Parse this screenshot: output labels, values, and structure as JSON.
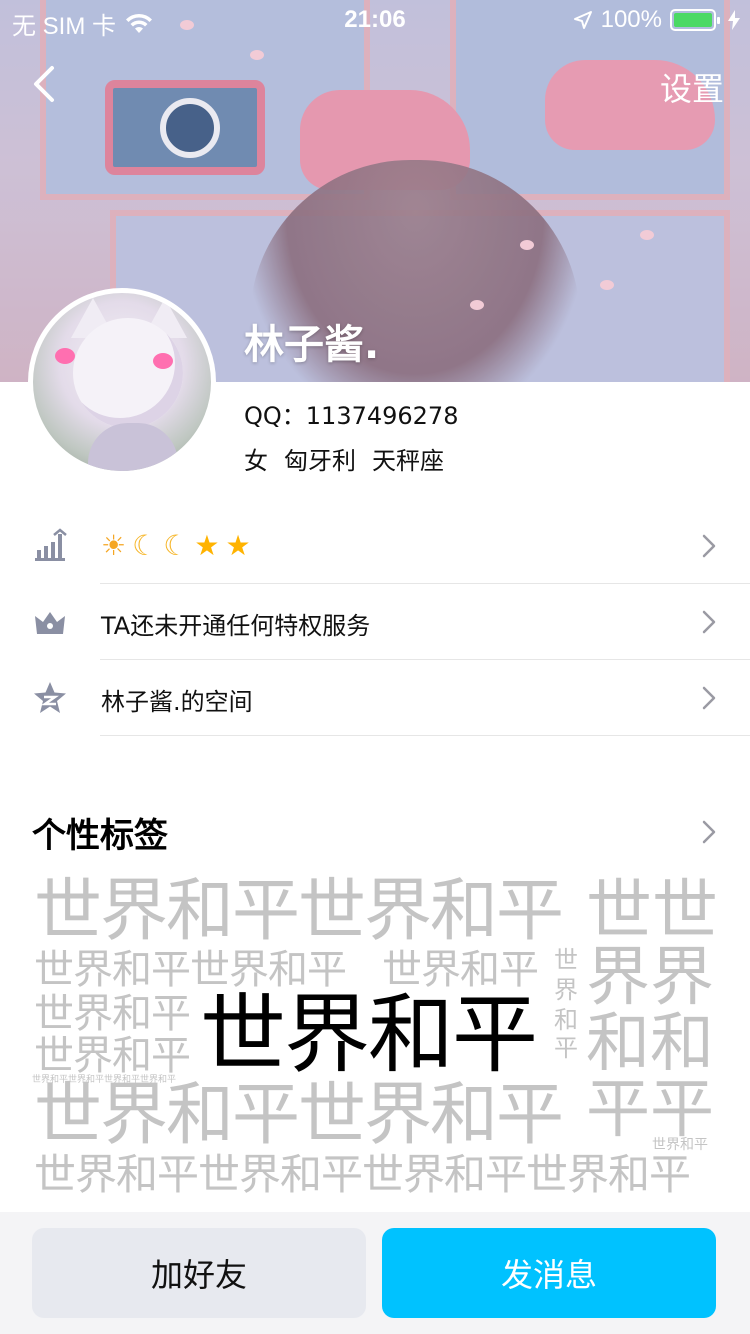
{
  "status_bar": {
    "carrier": "无 SIM 卡",
    "time": "21:06",
    "battery": "100%",
    "battery_level": 1.0
  },
  "nav": {
    "settings_label": "设置"
  },
  "profile": {
    "name": "林子酱.",
    "qq": "QQ：1137496278",
    "gender": "女",
    "country": "匈牙利",
    "zodiac": "天秤座"
  },
  "rows": {
    "level": {
      "icons": [
        "sun-icon",
        "moon-icon",
        "moon-icon",
        "star-icon",
        "star-icon"
      ]
    },
    "privilege": {
      "label": "TA还未开通任何特权服务"
    },
    "space": {
      "label": "林子酱.的空间"
    }
  },
  "tags": {
    "title": "个性标签",
    "main": "世界和平",
    "cloud": [
      "世界和平世界和平",
      "世世",
      "世界和平世界和平",
      "世界和平",
      "世",
      "界",
      "和",
      "平",
      "界界",
      "世界和平",
      "和和",
      "世界和平",
      "世界和平世界和平世界和平世界和平",
      "世界和平世界和平",
      "平平",
      "世界和平",
      "世界和平世界和平世界和平世界和平"
    ]
  },
  "actions": {
    "add_friend": "加好友",
    "send_message": "发消息"
  },
  "colors": {
    "accent": "#00c2ff",
    "battery": "#4cd964",
    "tag_gray": "#c4c4c4"
  }
}
